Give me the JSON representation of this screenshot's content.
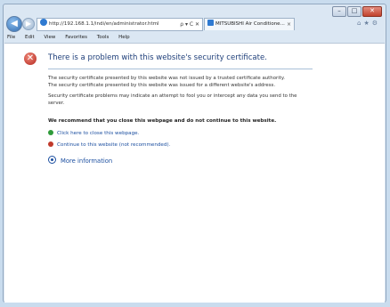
{
  "browser": {
    "address": "http://192.168.1.1/indi/en/administrator.html",
    "address_controls": "⍴ ▾ C ✕",
    "tab_title": "MITSUBISHI Air Conditione...",
    "tab_close": "×"
  },
  "menu": {
    "file": "File",
    "edit": "Edit",
    "view": "View",
    "favorites": "Favorites",
    "tools": "Tools",
    "help": "Help"
  },
  "page": {
    "title": "There is a problem with this website's security certificate.",
    "para1_line1": "The security certificate presented by this website was not issued by a trusted certificate authority.",
    "para1_line2": "The security certificate presented by this website was issued for a different website's address.",
    "para2_line1": "Security certificate problems may indicate an attempt to fool you or intercept any data you send to the",
    "para2_line2": "server.",
    "recommend": "We recommend that you close this webpage and do not continue to this website.",
    "close_link": "Click here to close this webpage.",
    "continue_link": "Continue to this website (not recommended).",
    "more_info": "More information"
  },
  "colors": {
    "title": "#1f3f7a",
    "link": "#1c4fa0",
    "shield": "#b3261e"
  }
}
